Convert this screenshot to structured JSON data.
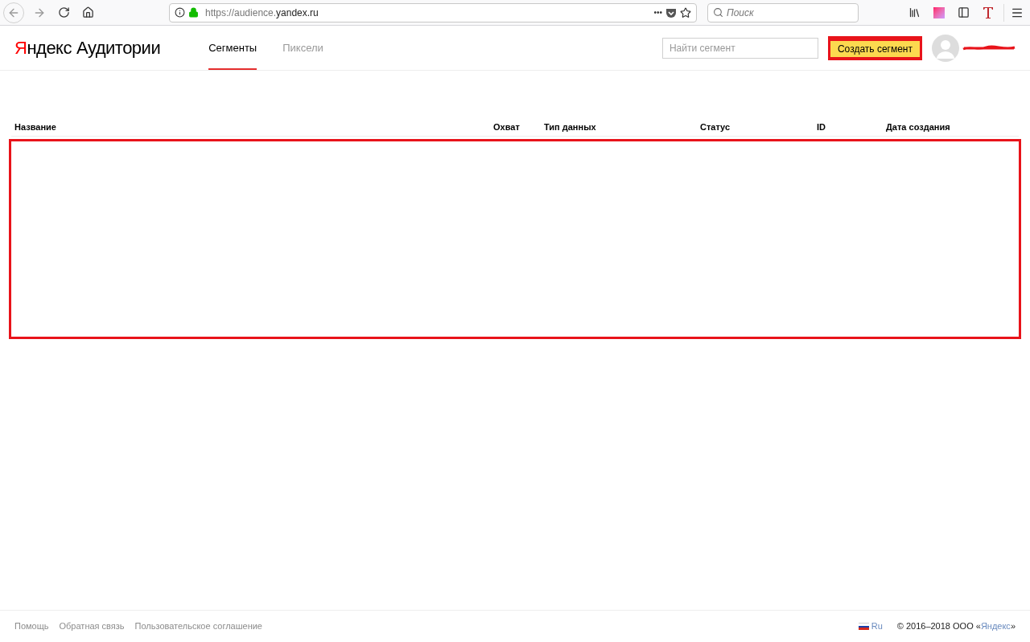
{
  "browser": {
    "url_prefix": "https://audience.",
    "url_domain": "yandex.ru",
    "search_placeholder": "Поиск",
    "menu_dots": "•••"
  },
  "header": {
    "logo": {
      "first": "Я",
      "rest": "ндекс",
      "product": "Аудитории"
    },
    "tabs": [
      {
        "label": "Сегменты",
        "selected": true
      },
      {
        "label": "Пиксели",
        "selected": false
      }
    ],
    "search": {
      "placeholder": "Найти сегмент"
    },
    "create_button": {
      "label": "Создать сегмент",
      "highlighted": true
    }
  },
  "table": {
    "columns": [
      "Название",
      "Охват",
      "Тип данных",
      "Статус",
      "ID",
      "Дата создания"
    ],
    "body_highlighted": true
  },
  "footer": {
    "links": [
      "Помощь",
      "Обратная связь",
      "Пользовательское соглашение"
    ],
    "language": "Ru",
    "copyright_before": "© 2016–2018 ООО «",
    "copyright_link": "Яндекс",
    "copyright_after": "»"
  }
}
